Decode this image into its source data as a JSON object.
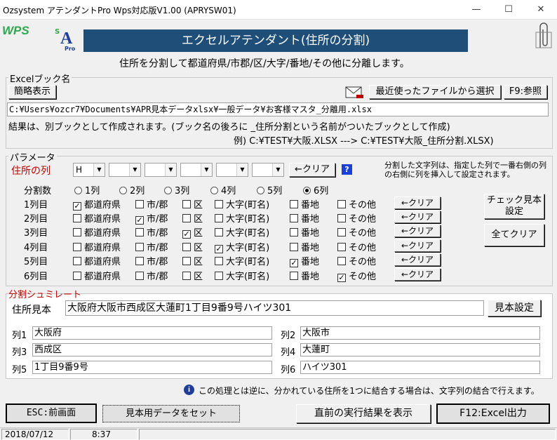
{
  "window": {
    "title": "Ozsystem アテンダントPro Wps対応版V1.00 (APRYSW01)",
    "minimize": "—",
    "maximize": "☐",
    "close": "✕"
  },
  "logos": {
    "wps": "WPS",
    "sa_s": "S",
    "sa_a": "A",
    "sa_pro": "Pro"
  },
  "header": {
    "banner": "エクセルアテンダント(住所の分割)",
    "subtitle": "住所を分割して都道府県/市郡/区/大字/番地/その他に分離します。"
  },
  "excel_book": {
    "group_label": "Excelブック名",
    "brief_button": "簡略表示",
    "recent_button": "最近使ったファイルから選択",
    "browse_button": "F9:参照",
    "path": "C:¥Users¥ozcr7¥Documents¥APR見本データxlsx¥一般データ¥お客様マスタ_分離用.xlsx",
    "note": "結果は、別ブックとして作成されます。(ブック名の後ろに _住所分割という名前がついたブックとして作成)",
    "example": "例) C:¥TEST¥大阪.XLSX ---> C:¥TEST¥大阪_住所分割.XLSX)"
  },
  "params": {
    "group_label": "パラメータ",
    "address_col_label": "住所の列",
    "col_combos": [
      "H",
      "",
      "",
      "",
      "",
      ""
    ],
    "clear_button": "←クリア",
    "help_icon": "?",
    "note": "分割した文字列は、指定した列で一番右側の列の右側に列を挿入して設定されます。",
    "split_count_label": "分割数",
    "split_options": [
      "1列",
      "2列",
      "3列",
      "4列",
      "5列",
      "6列"
    ],
    "split_selected": 5,
    "categories": [
      "都道府県",
      "市/郡",
      "区",
      "大字(町名)",
      "番地",
      "その他"
    ],
    "rows": [
      {
        "label": "1列目",
        "checked": [
          true,
          false,
          false,
          false,
          false,
          false
        ],
        "clear": "←クリア"
      },
      {
        "label": "2列目",
        "checked": [
          false,
          true,
          false,
          false,
          false,
          false
        ],
        "clear": "←クリア"
      },
      {
        "label": "3列目",
        "checked": [
          false,
          false,
          true,
          false,
          false,
          false
        ],
        "clear": "←クリア"
      },
      {
        "label": "4列目",
        "checked": [
          false,
          false,
          false,
          true,
          false,
          false
        ],
        "clear": "←クリア"
      },
      {
        "label": "5列目",
        "checked": [
          false,
          false,
          false,
          false,
          true,
          false
        ],
        "clear": "←クリア"
      },
      {
        "label": "6列目",
        "checked": [
          false,
          false,
          false,
          false,
          false,
          true
        ],
        "clear": "←クリア"
      }
    ],
    "check_sample_button": "チェック見本\n設定",
    "clear_all_button": "全てクリア"
  },
  "simulate": {
    "group_label": "分割シュミレート",
    "sample_label": "住所見本",
    "sample_value": "大阪府大阪市西成区大蓮町1丁目9番9号ハイツ301",
    "sample_button": "見本設定",
    "results": [
      {
        "label": "列1",
        "value": "大阪府"
      },
      {
        "label": "列2",
        "value": "大阪市"
      },
      {
        "label": "列3",
        "value": "西成区"
      },
      {
        "label": "列4",
        "value": "大蓮町"
      },
      {
        "label": "列5",
        "value": "1丁目9番9号"
      },
      {
        "label": "列6",
        "value": "ハイツ301"
      }
    ]
  },
  "info": {
    "icon": "i",
    "text": "この処理とは逆に、分かれている住所を1つに結合する場合は、文字列の結合で行えます。"
  },
  "footer": {
    "esc_button": "ESC:前画面",
    "set_sample_button": "見本用データをセット",
    "show_result_button": "直前の実行結果を表示",
    "excel_output_button": "F12:Excel出力"
  },
  "status": {
    "date": "2018/07/12",
    "time": "8:37"
  }
}
